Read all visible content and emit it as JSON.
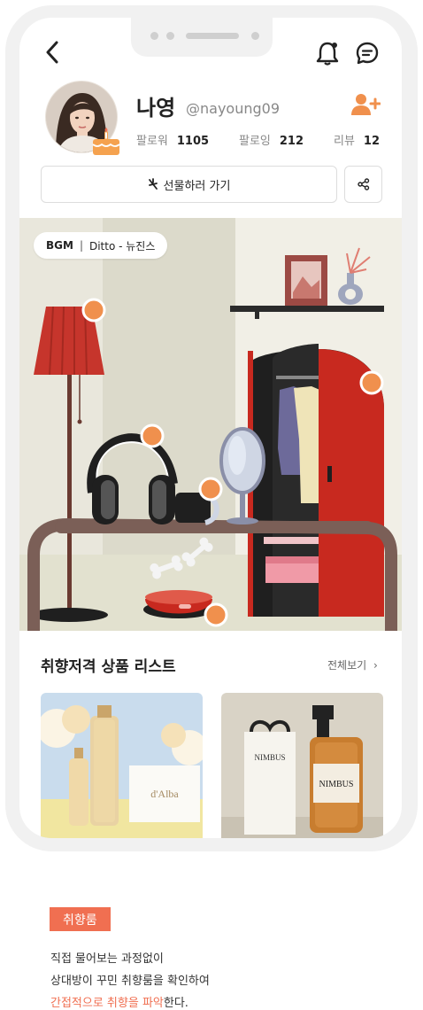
{
  "profile": {
    "name": "나영",
    "handle": "@nayoung09",
    "followers_label": "팔로워",
    "followers": "1105",
    "following_label": "팔로잉",
    "following": "212",
    "reviews_label": "리뷰",
    "reviews": "12"
  },
  "actions": {
    "gift_label": "선물하러 가기"
  },
  "bgm": {
    "label": "BGM",
    "song": "Ditto - 뉴진스"
  },
  "products": {
    "title": "취향저격 상품 리스트",
    "view_all": "전체보기",
    "items": [
      {
        "brand": "d'Alba"
      },
      {
        "brand": "NIMBUS"
      }
    ]
  },
  "caption": {
    "tag": "취향룸",
    "line1": "직접 물어보는 과정없이",
    "line2": "상대방이 꾸민 취향룸을 확인하여",
    "line3_highlight": "간접적으로 취향을 파악",
    "line3_rest": "한다."
  },
  "colors": {
    "accent": "#f06f51",
    "hotspot": "#f0904d",
    "wardrobe": "#c8291f"
  },
  "icons": [
    "back-icon",
    "bell-icon",
    "chat-icon",
    "add-friend-icon",
    "gift-icon",
    "share-icon",
    "chevron-right-icon",
    "cake-icon"
  ]
}
